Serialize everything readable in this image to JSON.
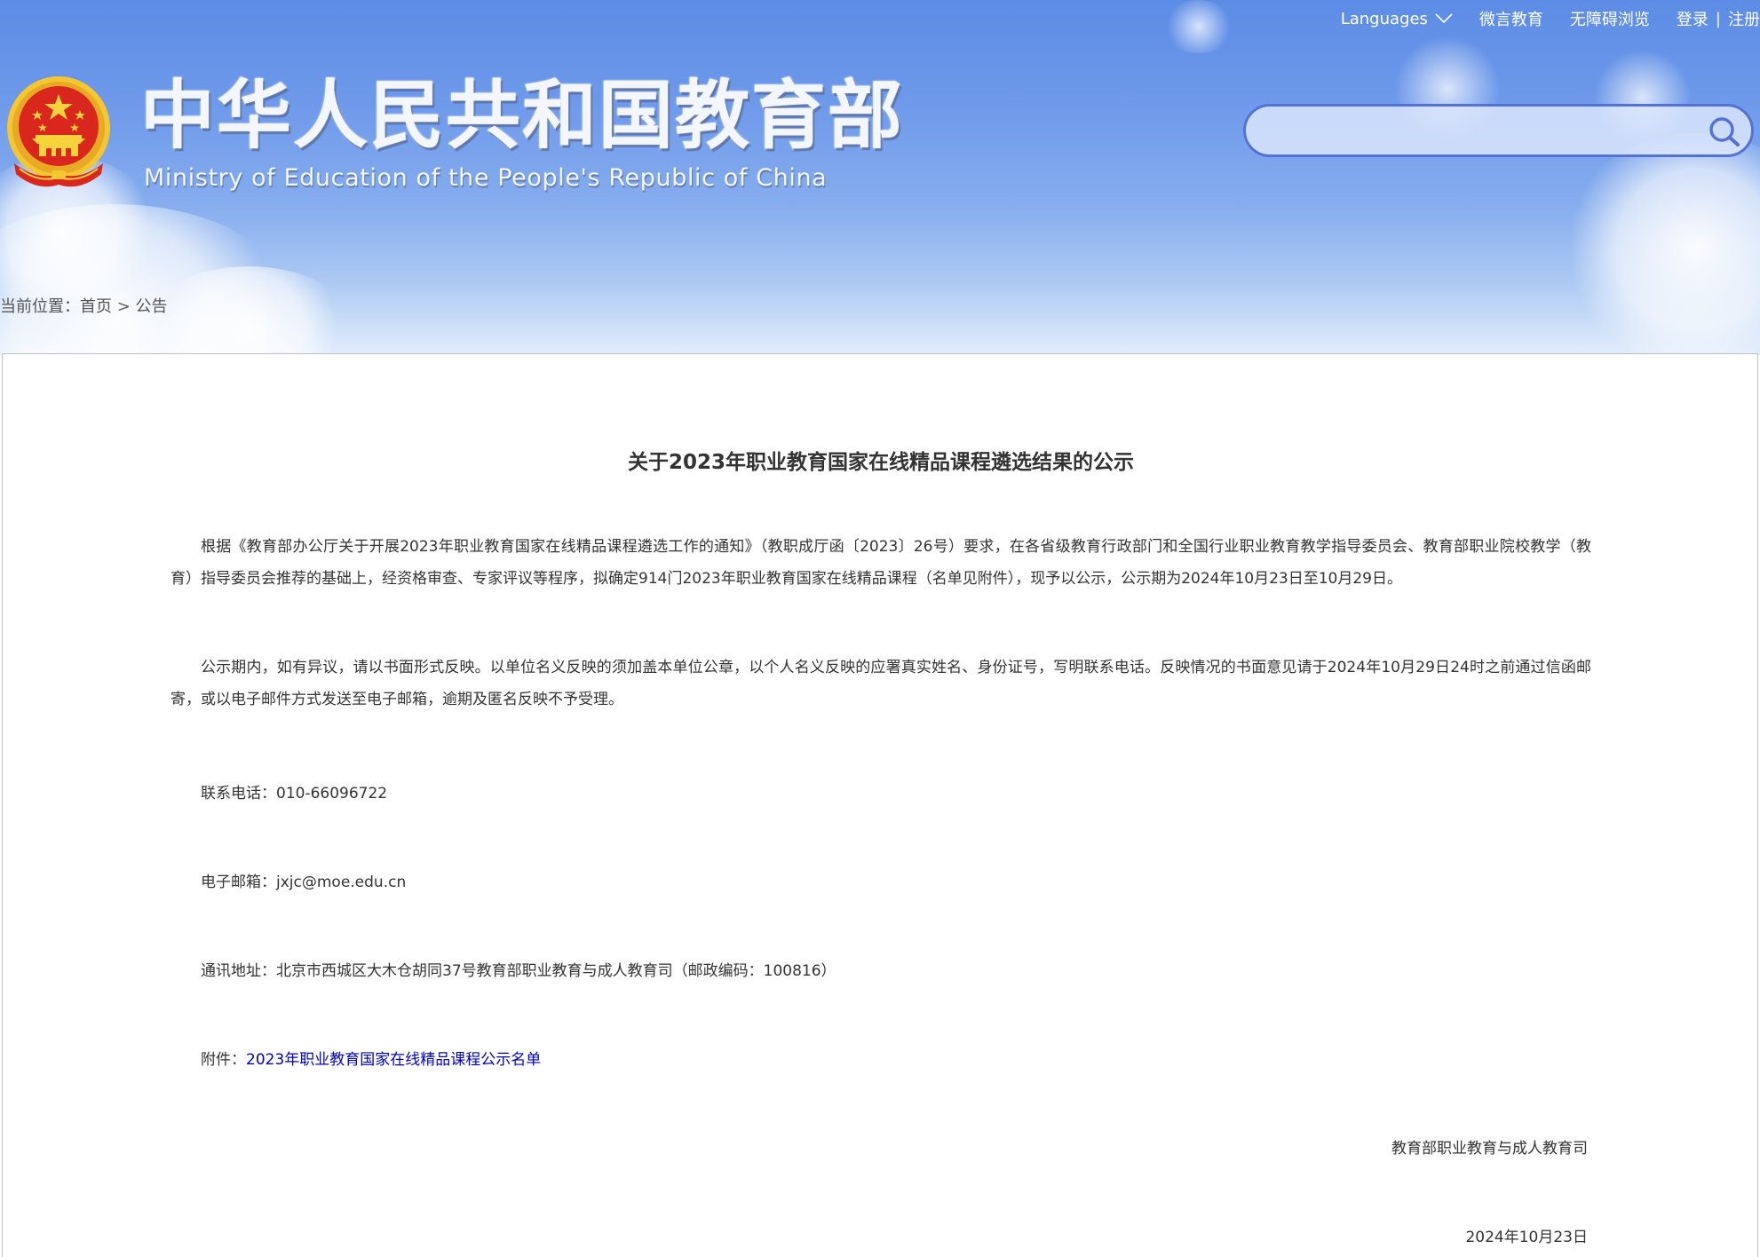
{
  "header": {
    "top_links": {
      "languages": "Languages",
      "weiyan": "微言教育",
      "accessibility": "无障碍浏览",
      "login": "登录",
      "separator": "|",
      "register": "注册"
    },
    "title_cn": "中华人民共和国教育部",
    "title_en": "Ministry of Education of the People's Republic of China",
    "search": {
      "placeholder": "",
      "value": ""
    }
  },
  "breadcrumb": {
    "prefix": "当前位置：",
    "home": "首页",
    "separator": " > ",
    "current": "公告"
  },
  "article": {
    "title": "关于2023年职业教育国家在线精品课程遴选结果的公示",
    "paragraph1": "根据《教育部办公厅关于开展2023年职业教育国家在线精品课程遴选工作的通知》（教职成厅函〔2023〕26号）要求，在各省级教育行政部门和全国行业职业教育教学指导委员会、教育部职业院校教学（教育）指导委员会推荐的基础上，经资格审查、专家评议等程序，拟确定914门2023年职业教育国家在线精品课程（名单见附件），现予以公示，公示期为2024年10月23日至10月29日。",
    "paragraph2": "公示期内，如有异议，请以书面形式反映。以单位名义反映的须加盖本单位公章，以个人名义反映的应署真实姓名、身份证号，写明联系电话。反映情况的书面意见请于2024年10月29日24时之前通过信函邮寄，或以电子邮件方式发送至电子邮箱，逾期及匿名反映不予受理。",
    "phone": "联系电话：010-66096722",
    "email": "电子邮箱：jxjc@moe.edu.cn",
    "address": "通讯地址：北京市西城区大木仓胡同37号教育部职业教育与成人教育司（邮政编码：100816）",
    "attachment_label": "附件：",
    "attachment_link": "2023年职业教育国家在线精品课程公示名单",
    "issuer": "教育部职业教育与成人教育司",
    "date": "2024年10月23日"
  },
  "colors": {
    "header_blue": "#5d8ce6",
    "search_border": "#5472d4",
    "link_blue": "#0000cc",
    "text": "#333333",
    "emblem_red": "#d9271e",
    "emblem_gold": "#f3c632"
  },
  "icons": {
    "emblem": "national-emblem-icon",
    "search": "search-icon",
    "languages_dropdown": "chevron-down-icon"
  }
}
